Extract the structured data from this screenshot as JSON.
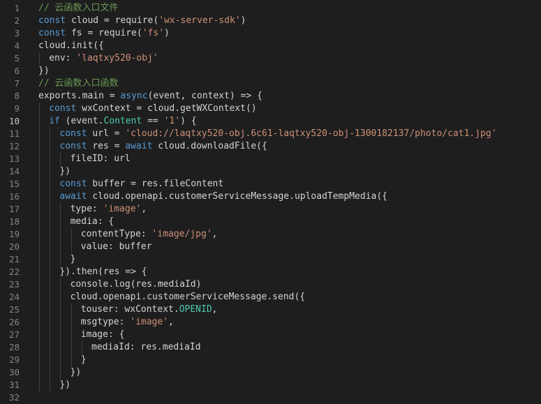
{
  "editor": {
    "active_line": 10,
    "colors": {
      "background": "#1e1e1e",
      "gutter_text": "#858585",
      "active_gutter_text": "#c6c6c6",
      "keyword": "#569cd6",
      "string": "#ce9178",
      "comment": "#6a9955",
      "property": "#4ec9b0",
      "plain": "#d4d4d4",
      "indent_guide": "#404040"
    },
    "lines": [
      {
        "n": "1",
        "indent": 0,
        "tokens": [
          {
            "t": "// 云函数入口文件",
            "c": "cm"
          }
        ]
      },
      {
        "n": "2",
        "indent": 0,
        "tokens": [
          {
            "t": "const",
            "c": "kw"
          },
          {
            "t": " cloud = require(",
            "c": "plain"
          },
          {
            "t": "'wx-server-sdk'",
            "c": "str"
          },
          {
            "t": ")",
            "c": "plain"
          }
        ]
      },
      {
        "n": "3",
        "indent": 0,
        "tokens": [
          {
            "t": "const",
            "c": "kw"
          },
          {
            "t": " fs = require(",
            "c": "plain"
          },
          {
            "t": "'fs'",
            "c": "str"
          },
          {
            "t": ")",
            "c": "plain"
          }
        ]
      },
      {
        "n": "4",
        "indent": 0,
        "tokens": [
          {
            "t": "cloud.init({",
            "c": "plain"
          }
        ]
      },
      {
        "n": "5",
        "indent": 1,
        "tokens": [
          {
            "t": "env: ",
            "c": "plain"
          },
          {
            "t": "'laqtxy520-obj'",
            "c": "str"
          }
        ]
      },
      {
        "n": "6",
        "indent": 0,
        "tokens": [
          {
            "t": "})",
            "c": "plain"
          }
        ]
      },
      {
        "n": "7",
        "indent": 0,
        "tokens": [
          {
            "t": "// 云函数入口函数",
            "c": "cm"
          }
        ]
      },
      {
        "n": "8",
        "indent": 0,
        "tokens": [
          {
            "t": "exports.main = ",
            "c": "plain"
          },
          {
            "t": "async",
            "c": "kw"
          },
          {
            "t": "(event, context) => {",
            "c": "plain"
          }
        ]
      },
      {
        "n": "9",
        "indent": 1,
        "tokens": [
          {
            "t": "const",
            "c": "kw"
          },
          {
            "t": " wxContext = cloud.getWXContext()",
            "c": "plain"
          }
        ]
      },
      {
        "n": "10",
        "indent": 1,
        "tokens": [
          {
            "t": "if",
            "c": "kw"
          },
          {
            "t": " (event.",
            "c": "plain"
          },
          {
            "t": "Content",
            "c": "prop"
          },
          {
            "t": " == ",
            "c": "plain"
          },
          {
            "t": "'1'",
            "c": "str"
          },
          {
            "t": ") {",
            "c": "plain"
          }
        ]
      },
      {
        "n": "11",
        "indent": 2,
        "tokens": [
          {
            "t": "const",
            "c": "kw"
          },
          {
            "t": " url = ",
            "c": "plain"
          },
          {
            "t": "'cloud://laqtxy520-obj.6c61-laqtxy520-obj-1300182137/photo/cat1.jpg'",
            "c": "str"
          }
        ]
      },
      {
        "n": "12",
        "indent": 2,
        "tokens": [
          {
            "t": "const",
            "c": "kw"
          },
          {
            "t": " res = ",
            "c": "plain"
          },
          {
            "t": "await",
            "c": "kw"
          },
          {
            "t": " cloud.downloadFile({",
            "c": "plain"
          }
        ]
      },
      {
        "n": "13",
        "indent": 3,
        "tokens": [
          {
            "t": "fileID: url",
            "c": "plain"
          }
        ]
      },
      {
        "n": "14",
        "indent": 2,
        "tokens": [
          {
            "t": "})",
            "c": "plain"
          }
        ]
      },
      {
        "n": "15",
        "indent": 2,
        "tokens": [
          {
            "t": "const",
            "c": "kw"
          },
          {
            "t": " buffer = res.fileContent",
            "c": "plain"
          }
        ]
      },
      {
        "n": "16",
        "indent": 2,
        "tokens": [
          {
            "t": "await",
            "c": "kw"
          },
          {
            "t": " cloud.openapi.customerServiceMessage.uploadTempMedia({",
            "c": "plain"
          }
        ]
      },
      {
        "n": "17",
        "indent": 3,
        "tokens": [
          {
            "t": "type: ",
            "c": "plain"
          },
          {
            "t": "'image'",
            "c": "str"
          },
          {
            "t": ",",
            "c": "plain"
          }
        ]
      },
      {
        "n": "18",
        "indent": 3,
        "tokens": [
          {
            "t": "media: {",
            "c": "plain"
          }
        ]
      },
      {
        "n": "19",
        "indent": 4,
        "tokens": [
          {
            "t": "contentType: ",
            "c": "plain"
          },
          {
            "t": "'image/jpg'",
            "c": "str"
          },
          {
            "t": ",",
            "c": "plain"
          }
        ]
      },
      {
        "n": "20",
        "indent": 4,
        "tokens": [
          {
            "t": "value: buffer",
            "c": "plain"
          }
        ]
      },
      {
        "n": "21",
        "indent": 3,
        "tokens": [
          {
            "t": "}",
            "c": "plain"
          }
        ]
      },
      {
        "n": "22",
        "indent": 2,
        "tokens": [
          {
            "t": "}).then(res => {",
            "c": "plain"
          }
        ]
      },
      {
        "n": "23",
        "indent": 3,
        "tokens": [
          {
            "t": "console.log(res.mediaId)",
            "c": "plain"
          }
        ]
      },
      {
        "n": "24",
        "indent": 3,
        "tokens": [
          {
            "t": "cloud.openapi.customerServiceMessage.send({",
            "c": "plain"
          }
        ]
      },
      {
        "n": "25",
        "indent": 4,
        "tokens": [
          {
            "t": "touser: wxContext.",
            "c": "plain"
          },
          {
            "t": "OPENID",
            "c": "prop"
          },
          {
            "t": ",",
            "c": "plain"
          }
        ]
      },
      {
        "n": "26",
        "indent": 4,
        "tokens": [
          {
            "t": "msgtype: ",
            "c": "plain"
          },
          {
            "t": "'image'",
            "c": "str"
          },
          {
            "t": ",",
            "c": "plain"
          }
        ]
      },
      {
        "n": "27",
        "indent": 4,
        "tokens": [
          {
            "t": "image: {",
            "c": "plain"
          }
        ]
      },
      {
        "n": "28",
        "indent": 5,
        "tokens": [
          {
            "t": "mediaId: res.mediaId",
            "c": "plain"
          }
        ]
      },
      {
        "n": "29",
        "indent": 4,
        "tokens": [
          {
            "t": "}",
            "c": "plain"
          }
        ]
      },
      {
        "n": "30",
        "indent": 3,
        "tokens": [
          {
            "t": "})",
            "c": "plain"
          }
        ]
      },
      {
        "n": "31",
        "indent": 2,
        "tokens": [
          {
            "t": "})",
            "c": "plain"
          }
        ]
      },
      {
        "n": "32",
        "indent": 0,
        "tokens": []
      }
    ]
  }
}
